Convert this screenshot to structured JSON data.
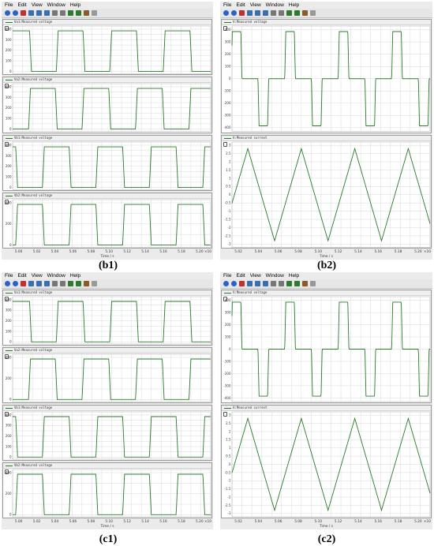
{
  "menu": [
    "File",
    "Edit",
    "View",
    "Window",
    "Help"
  ],
  "colors": {
    "trace": "#2a7a2a",
    "grid": "#d9d9d9",
    "axis": "#555555",
    "window_bg": "#ebebeb"
  },
  "toolbar_icons": [
    "back-icon",
    "forward-icon",
    "stop-icon",
    "zoom-icon",
    "zoom-box-icon",
    "zoom-fit-icon",
    "pan-icon",
    "cursor-icon",
    "graph-icon",
    "export-icon",
    "print-icon",
    "copy-icon"
  ],
  "figures": [
    {
      "id": "b1",
      "caption": "(b1)",
      "x_ticks": [
        "5.00",
        "5.02",
        "5.04",
        "5.06",
        "5.08",
        "5.10",
        "5.12",
        "5.14",
        "5.16",
        "5.18",
        "5.20"
      ],
      "x_title": "Time / s",
      "x_exponent": "×10",
      "panels": [
        {
          "title": "Va1:Measured voltage",
          "signal": "sq0",
          "yticks": [
            "0",
            "100",
            "200",
            "300",
            "400"
          ],
          "ymin": -20,
          "ymax": 430
        },
        {
          "title": "Va2:Measured voltage",
          "signal": "sq1",
          "yticks": [
            "0",
            "100",
            "200",
            "300",
            "400"
          ],
          "ymin": -20,
          "ymax": 430
        },
        {
          "title": "Vb1:Measured voltage",
          "signal": "sq2",
          "yticks": [
            "0",
            "100",
            "200",
            "300",
            "400"
          ],
          "ymin": -20,
          "ymax": 430
        },
        {
          "title": "Vb2:Measured voltage",
          "signal": "sq3",
          "yticks": [
            "0",
            "200",
            "400"
          ],
          "ymin": -20,
          "ymax": 430
        }
      ]
    },
    {
      "id": "b2",
      "caption": "(b2)",
      "x_ticks": [
        "5.02",
        "5.04",
        "5.06",
        "5.08",
        "5.10",
        "5.12",
        "5.14",
        "5.16",
        "5.18",
        "5.20"
      ],
      "x_title": "Time / s",
      "x_exponent": "×10",
      "panels": [
        {
          "title": "V:Measured voltage",
          "signal": "tri",
          "yticks": [
            "-400",
            "-300",
            "-200",
            "-100",
            "0",
            "100",
            "200",
            "300",
            "400"
          ],
          "ymin": -430,
          "ymax": 430
        },
        {
          "title": "A:Measured current",
          "signal": "cur",
          "yticks": [
            "-3",
            "-2.5",
            "-2",
            "-1.5",
            "-1",
            "-0.5",
            "0",
            "0.5",
            "1",
            "1.5",
            "2",
            "2.5",
            "3"
          ],
          "ymin": -3.2,
          "ymax": 3.2
        }
      ]
    },
    {
      "id": "c1",
      "caption": "(c1)",
      "x_ticks": [
        "5.00",
        "5.02",
        "5.04",
        "5.06",
        "5.08",
        "5.10",
        "5.12",
        "5.14",
        "5.16",
        "5.18",
        "5.20"
      ],
      "x_title": "Time / s",
      "x_exponent": "×10",
      "panels": [
        {
          "title": "Va1:Measured voltage",
          "signal": "sq0",
          "yticks": [
            "0",
            "100",
            "200",
            "300",
            "400"
          ],
          "ymin": -20,
          "ymax": 430
        },
        {
          "title": "Va2:Measured voltage",
          "signal": "sq1",
          "yticks": [
            "0",
            "200",
            "400"
          ],
          "ymin": -20,
          "ymax": 430
        },
        {
          "title": "Vb1:Measured voltage",
          "signal": "sq2",
          "yticks": [
            "0",
            "100",
            "200",
            "300",
            "400"
          ],
          "ymin": -20,
          "ymax": 430
        },
        {
          "title": "Vb2:Measured voltage",
          "signal": "sq3",
          "yticks": [
            "0",
            "200",
            "400"
          ],
          "ymin": -20,
          "ymax": 430
        }
      ]
    },
    {
      "id": "c2",
      "caption": "(c2)",
      "x_ticks": [
        "5.02",
        "5.04",
        "5.06",
        "5.08",
        "5.10",
        "5.12",
        "5.14",
        "5.16",
        "5.18",
        "5.20"
      ],
      "x_title": "Time / s",
      "x_exponent": "×10",
      "panels": [
        {
          "title": "V:Measured voltage",
          "signal": "tri",
          "yticks": [
            "-400",
            "-300",
            "-200",
            "-100",
            "0",
            "100",
            "200",
            "300",
            "400"
          ],
          "ymin": -430,
          "ymax": 430
        },
        {
          "title": "A:Measured current",
          "signal": "cur",
          "yticks": [
            "-3",
            "-2.5",
            "-2",
            "-1.5",
            "-1",
            "-0.5",
            "0",
            "0.5",
            "1",
            "1.5",
            "2",
            "2.5",
            "3"
          ],
          "ymin": -3.2,
          "ymax": 3.2
        }
      ]
    }
  ]
}
